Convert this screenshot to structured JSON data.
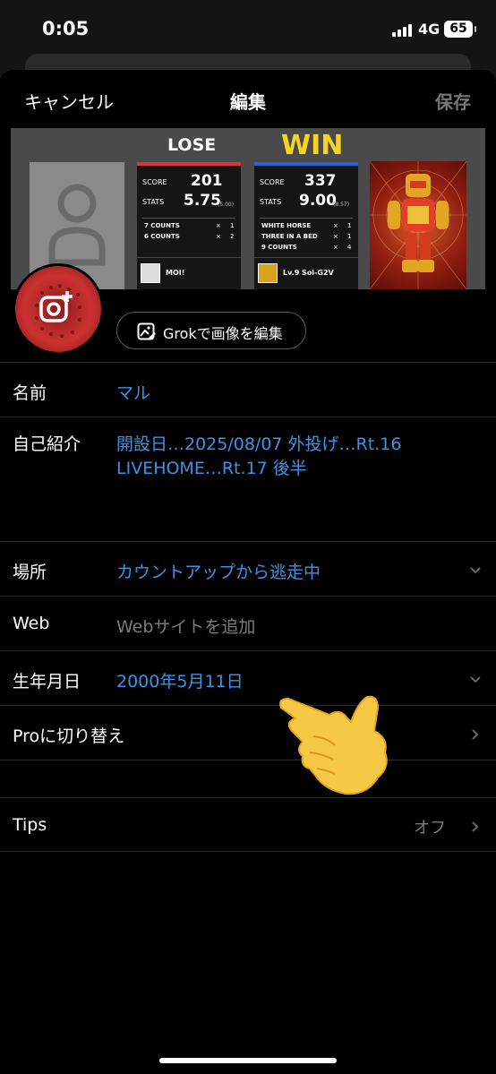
{
  "status_bar": {
    "time": "0:05",
    "network": "4G",
    "battery": "65"
  },
  "peek": {
    "lose": "LOSE",
    "win": "WIN"
  },
  "nav": {
    "cancel": "キャンセル",
    "title": "編集",
    "save": "保存"
  },
  "banner": {
    "lose": "LOSE",
    "win": "WIN",
    "left_panel": {
      "score_label": "SCORE",
      "score": "201",
      "stats_label": "STATS",
      "stats": "5.75",
      "stats_sub": "(5.00)",
      "awards": [
        {
          "name": "7 COUNTS",
          "count": "1"
        },
        {
          "name": "6 COUNTS",
          "count": "2"
        }
      ],
      "player": "MOI!"
    },
    "right_panel": {
      "score_label": "SCORE",
      "score": "337",
      "stats_label": "STATS",
      "stats": "9.00",
      "stats_sub": "(8.57)",
      "awards": [
        {
          "name": "WHITE HORSE",
          "count": "1"
        },
        {
          "name": "THREE IN A BED",
          "count": "1"
        },
        {
          "name": "9 COUNTS",
          "count": "4"
        }
      ],
      "player": "Lv.9 Sol-G2V"
    },
    "times": "×"
  },
  "grok": {
    "label": "Grokで画像を編集"
  },
  "form": {
    "name": {
      "label": "名前",
      "value": "マル"
    },
    "bio": {
      "label": "自己紹介",
      "line1": "開設日…2025/08/07 外投げ…Rt.16",
      "line2": "LIVEHOME…Rt.17 後半"
    },
    "location": {
      "label": "場所",
      "value": "カウントアップから逃走中"
    },
    "web": {
      "label": "Web",
      "placeholder": "Webサイトを追加"
    },
    "birthday": {
      "label": "生年月日",
      "value": "2000年5月11日"
    },
    "pro": {
      "label": "Proに切り替え"
    },
    "tips": {
      "label": "Tips",
      "value": "オフ"
    }
  },
  "colors": {
    "accent": "#3b93e6",
    "win": "#f5d422",
    "lose_bar": "#dd3333",
    "win_bar": "#2a62d6"
  }
}
